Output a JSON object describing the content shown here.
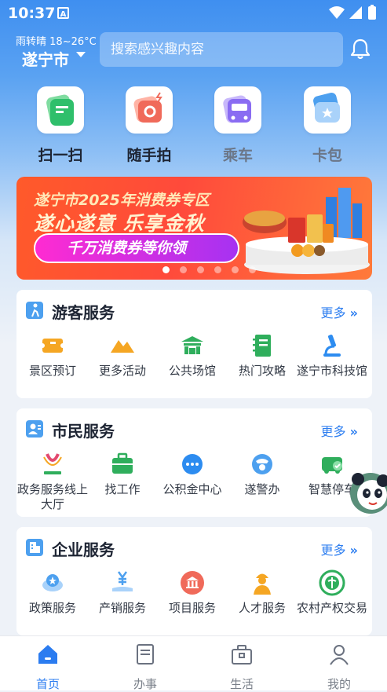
{
  "status_bar": {
    "time": "10:37",
    "notification": "A"
  },
  "header": {
    "weather": "雨转晴 18~26°C",
    "city": "遂宁市",
    "search_placeholder": "搜索感兴趣内容",
    "bell_icon": "bell-icon"
  },
  "quick_actions": [
    {
      "label": "扫一扫",
      "icon": "scan-icon",
      "color": "#2fbf6b"
    },
    {
      "label": "随手拍",
      "icon": "camera-icon",
      "color": "#f06a5a"
    },
    {
      "label": "乘车",
      "icon": "bus-icon",
      "color": "#8a6cf2"
    },
    {
      "label": "卡包",
      "icon": "card-wallet-icon",
      "color": "#4da0ef"
    }
  ],
  "banner": {
    "line1": "遂宁市2025年消费券专区",
    "line2": "遂心遂意 乐享金秋",
    "button": "千万消费券等你领",
    "slide_count": 6,
    "active_slide": 0
  },
  "sections": [
    {
      "title": "游客服务",
      "more": "更多",
      "items": [
        {
          "label": "景区预订",
          "icon": "ticket-icon",
          "color": "#f5a623"
        },
        {
          "label": "更多活动",
          "icon": "mountain-icon",
          "color": "#f5a623"
        },
        {
          "label": "公共场馆",
          "icon": "gate-icon",
          "color": "#2fae5c"
        },
        {
          "label": "热门攻略",
          "icon": "notebook-icon",
          "color": "#2fae5c"
        },
        {
          "label": "遂宁市科技馆",
          "icon": "microscope-icon",
          "color": "#2d8cf0"
        }
      ]
    },
    {
      "title": "市民服务",
      "more": "更多",
      "items": [
        {
          "label": "政务服务线上大厅",
          "icon": "gov-logo-icon",
          "color": "#e34a6f"
        },
        {
          "label": "找工作",
          "icon": "briefcase-icon",
          "color": "#2fae5c"
        },
        {
          "label": "公积金中心",
          "icon": "chat-dots-icon",
          "color": "#2d8cf0"
        },
        {
          "label": "遂警办",
          "icon": "police-icon",
          "color": "#4da0ef"
        },
        {
          "label": "智慧停车",
          "icon": "parking-icon",
          "color": "#2fae5c"
        }
      ]
    },
    {
      "title": "企业服务",
      "more": "更多",
      "items": [
        {
          "label": "政策服务",
          "icon": "policy-cloud-icon",
          "color": "#4da0ef"
        },
        {
          "label": "产销服务",
          "icon": "yen-hand-icon",
          "color": "#4da0ef"
        },
        {
          "label": "项目服务",
          "icon": "bank-icon",
          "color": "#f06a5a"
        },
        {
          "label": "人才服务",
          "icon": "worker-icon",
          "color": "#f5a623"
        },
        {
          "label": "农村产权交易",
          "icon": "farm-logo-icon",
          "color": "#2fae5c"
        }
      ]
    }
  ],
  "bottom_nav": [
    {
      "label": "首页",
      "icon": "home-icon",
      "active": true
    },
    {
      "label": "办事",
      "icon": "document-icon",
      "active": false
    },
    {
      "label": "生活",
      "icon": "bag-icon",
      "active": false
    },
    {
      "label": "我的",
      "icon": "user-icon",
      "active": false
    }
  ],
  "colors": {
    "accent": "#2b7cf0",
    "header_blue": "#3f8ff0"
  }
}
